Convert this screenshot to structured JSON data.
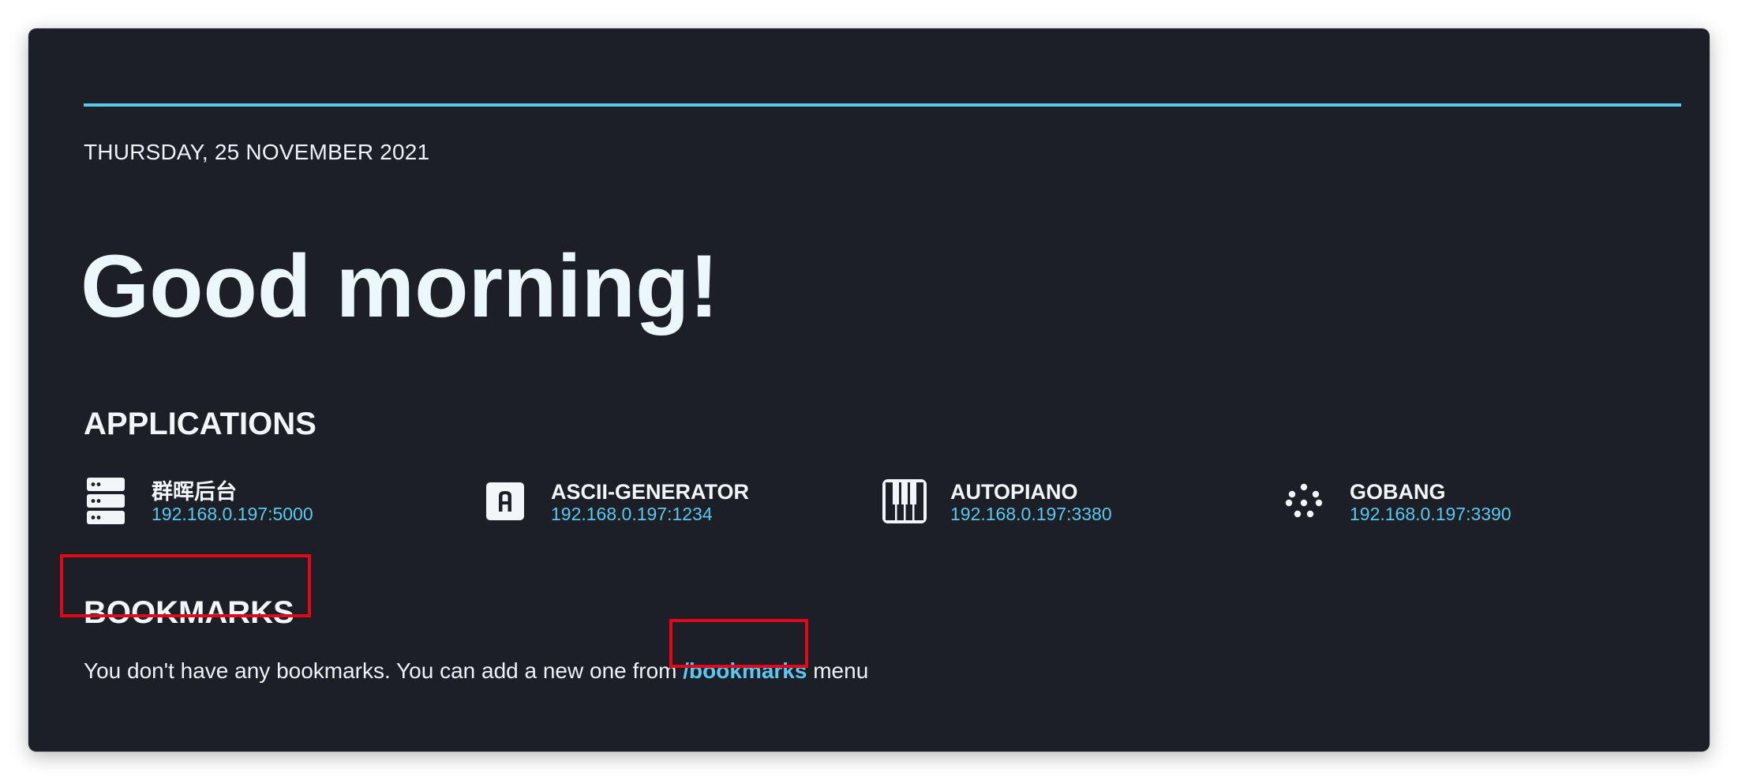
{
  "header": {
    "date": "THURSDAY, 25 NOVEMBER 2021",
    "greeting": "Good morning!",
    "accent_color": "#5bc8ef"
  },
  "applications": {
    "title": "APPLICATIONS",
    "items": [
      {
        "name": "群晖后台",
        "url": "192.168.0.197:5000",
        "icon": "server-icon"
      },
      {
        "name": "ASCII-GENERATOR",
        "url": "192.168.0.197:1234",
        "icon": "letter-a-icon"
      },
      {
        "name": "AUTOPIANO",
        "url": "192.168.0.197:3380",
        "icon": "piano-icon"
      },
      {
        "name": "GOBANG",
        "url": "192.168.0.197:3390",
        "icon": "dots-icon"
      }
    ]
  },
  "bookmarks": {
    "title": "BOOKMARKS",
    "empty_text_before": "You don't have any bookmarks. You can add a new one from ",
    "link_label": "/bookmarks",
    "empty_text_after": " menu"
  },
  "annotations": {
    "highlight_color": "#e2071a"
  }
}
